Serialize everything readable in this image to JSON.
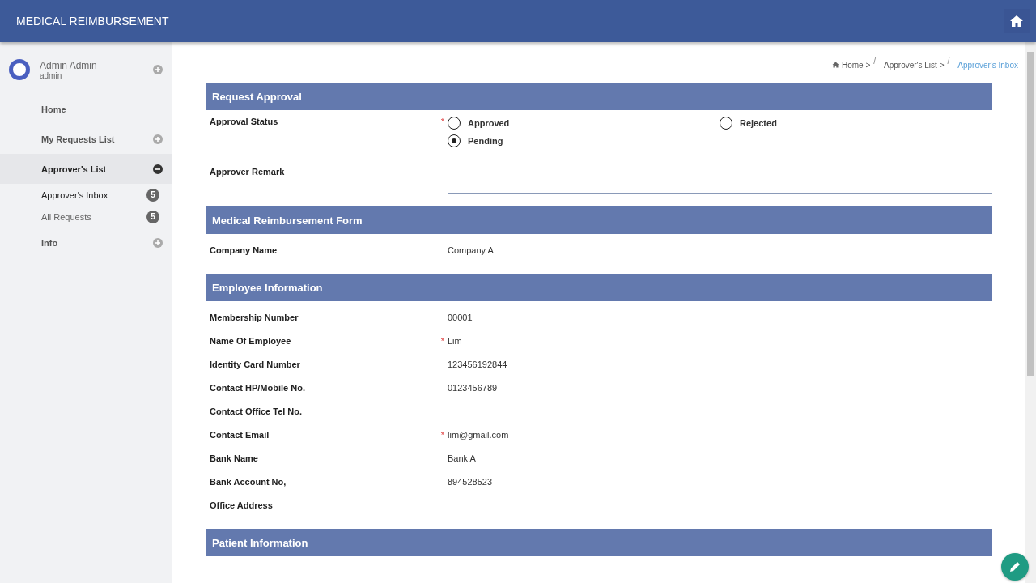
{
  "app_title": "MEDICAL REIMBURSEMENT",
  "user": {
    "name": "Admin Admin",
    "role": "admin",
    "expanded": false
  },
  "nav": [
    {
      "label": "Home",
      "kind": "link",
      "selected": false
    },
    {
      "label": "My Requests List",
      "kind": "group",
      "expanded": false,
      "selected": false
    },
    {
      "label": "Approver's List",
      "kind": "group",
      "expanded": true,
      "selected": true,
      "children": [
        {
          "label": "Approver's Inbox",
          "badge": "5",
          "selected": true
        },
        {
          "label": "All Requests",
          "badge": "5",
          "selected": false
        }
      ]
    },
    {
      "label": "Info",
      "kind": "group",
      "expanded": false,
      "selected": false
    }
  ],
  "breadcrumb": [
    {
      "label": "Home",
      "trail": ">",
      "divider": "/",
      "current": false
    },
    {
      "label": "Approver's List",
      "trail": ">",
      "divider": "/",
      "current": false
    },
    {
      "label": "Approver's Inbox",
      "current": true
    }
  ],
  "sections": [
    {
      "title": "Request Approval",
      "kind": "approval",
      "status_label": "Approval Status",
      "marker": "*",
      "options": [
        {
          "label": "Approved",
          "selected": false
        },
        {
          "label": "Rejected",
          "selected": false
        },
        {
          "label": "Pending",
          "selected": true
        }
      ],
      "remark_label": "Approver Remark"
    },
    {
      "title": "Medical Reimbursement Form",
      "kind": "fields",
      "rows": [
        {
          "label": "Company Name",
          "value": "Company A"
        }
      ]
    },
    {
      "title": "Employee Information",
      "kind": "fields",
      "rows": [
        {
          "label": "Membership Number",
          "value": "00001"
        },
        {
          "label": "Name Of Employee",
          "value": "Lim",
          "marker": "*"
        },
        {
          "label": "Identity Card Number",
          "value": "123456192844"
        },
        {
          "label": "Contact HP/Mobile No.",
          "value": "0123456789"
        },
        {
          "label": "Contact Office Tel No."
        },
        {
          "label": "Contact Email",
          "value": "lim@gmail.com",
          "marker": "*"
        },
        {
          "label": "Bank Name",
          "value": "Bank A"
        },
        {
          "label": "Bank Account No,",
          "value": "894528523"
        },
        {
          "label": "Office Address"
        }
      ]
    },
    {
      "title": "Patient Information",
      "kind": "fields"
    }
  ]
}
